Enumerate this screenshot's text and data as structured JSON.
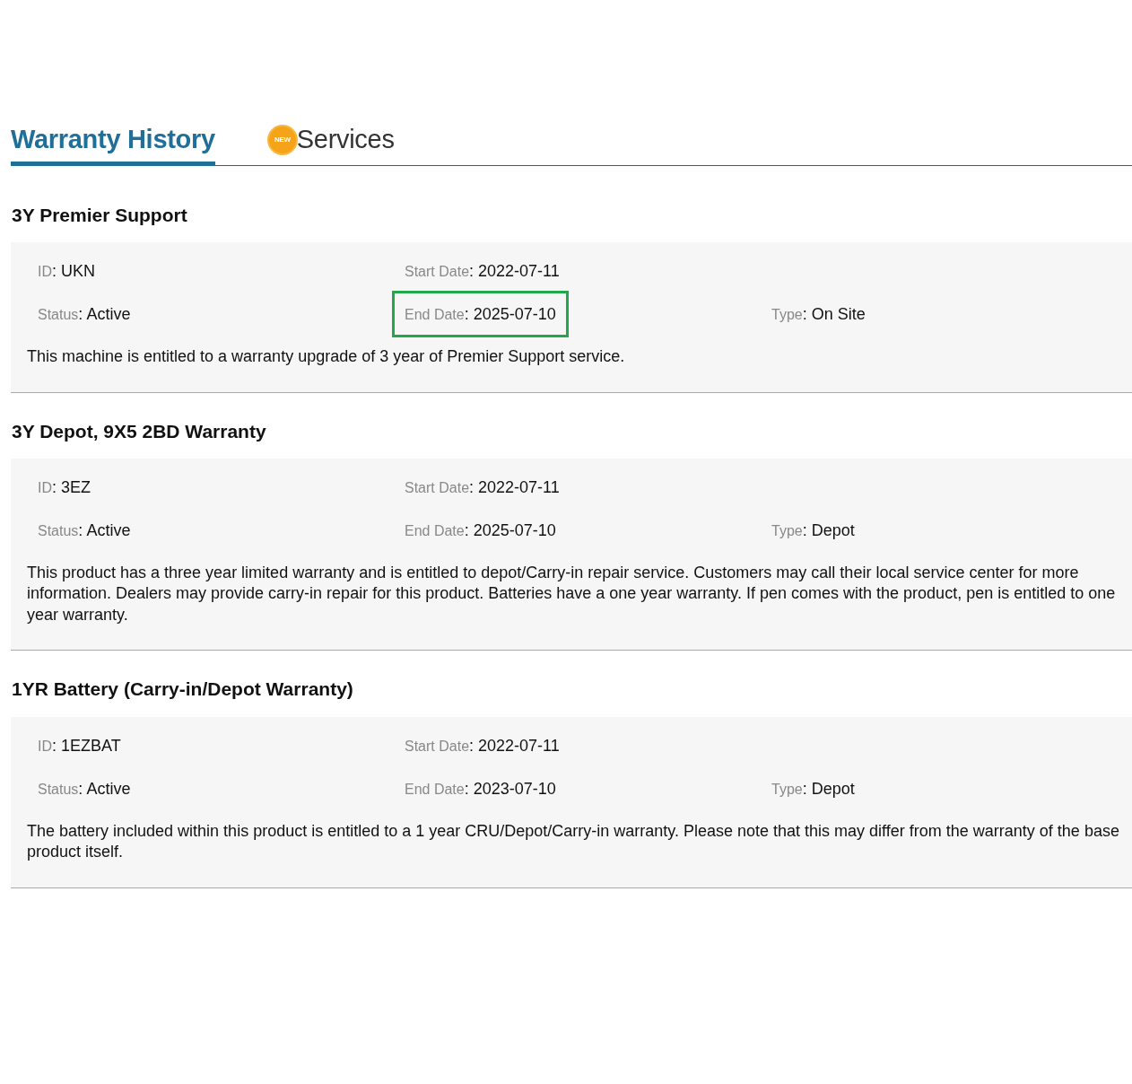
{
  "tabs": [
    {
      "label": "Warranty History",
      "selected": true
    },
    {
      "label": "Services",
      "selected": false,
      "badge": "NEW"
    }
  ],
  "separator": ":",
  "warranties": [
    {
      "title": "3Y Premier Support",
      "rows": [
        [
          {
            "label": "ID",
            "value": "UKN",
            "highlighted": false
          },
          {
            "label": "Start Date",
            "value": "2022-07-11",
            "highlighted": false
          }
        ],
        [
          {
            "label": "Status",
            "value": "Active",
            "highlighted": false
          },
          {
            "label": "End Date",
            "value": "2025-07-10",
            "highlighted": true
          },
          {
            "label": "Type",
            "value": "On Site",
            "highlighted": false
          }
        ]
      ],
      "description": "This machine is entitled to a warranty upgrade of 3 year of Premier Support service."
    },
    {
      "title": "3Y Depot, 9X5 2BD Warranty",
      "rows": [
        [
          {
            "label": "ID",
            "value": "3EZ",
            "highlighted": false
          },
          {
            "label": "Start Date",
            "value": "2022-07-11",
            "highlighted": false
          }
        ],
        [
          {
            "label": "Status",
            "value": "Active",
            "highlighted": false
          },
          {
            "label": "End Date",
            "value": "2025-07-10",
            "highlighted": false
          },
          {
            "label": "Type",
            "value": "Depot",
            "highlighted": false
          }
        ]
      ],
      "description": "This product has a three year limited warranty and is entitled to depot/Carry-in repair service. Customers may call their local service center for more information. Dealers may provide carry-in repair for this product. Batteries have a one year warranty. If pen comes with the product, pen is entitled to one year warranty."
    },
    {
      "title": "1YR Battery (Carry-in/Depot Warranty)",
      "rows": [
        [
          {
            "label": "ID",
            "value": "1EZBAT",
            "highlighted": false
          },
          {
            "label": "Start Date",
            "value": "2022-07-11",
            "highlighted": false
          }
        ],
        [
          {
            "label": "Status",
            "value": "Active",
            "highlighted": false
          },
          {
            "label": "End Date",
            "value": "2023-07-10",
            "highlighted": false
          },
          {
            "label": "Type",
            "value": "Depot",
            "highlighted": false
          }
        ]
      ],
      "description": "The battery included within this product is entitled to a 1 year CRU/Depot/Carry-in warranty. Please note that this may differ from the warranty of the base product itself."
    }
  ]
}
